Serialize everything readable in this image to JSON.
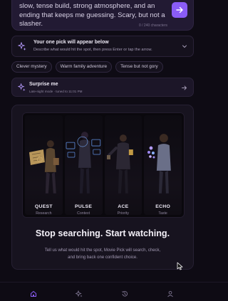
{
  "prompt": {
    "text": "slow, tense build, strong atmosphere, and an ending that keeps me guessing. Scary, but not a slasher.",
    "char_count": "0 / 240 characters"
  },
  "pick": {
    "title": "Your one pick will appear below",
    "subtitle": "Describe what would hit the spot, then press Enter or tap the arrow."
  },
  "chips": [
    "Clever mystery",
    "Warm family adventure",
    "Tense but not gory"
  ],
  "surprise": {
    "title": "Surprise me",
    "subtitle": "Late-night mode · tuned to 11:01 PM"
  },
  "agents": [
    {
      "name": "QUEST",
      "role": "Research"
    },
    {
      "name": "PULSE",
      "role": "Context"
    },
    {
      "name": "ACE",
      "role": "Priority"
    },
    {
      "name": "ECHO",
      "role": "Taste"
    }
  ],
  "hero": {
    "headline": "Stop searching. Start watching.",
    "body": "Tell us what would hit the spot, Movie Pick will search, check, and bring back one confident choice."
  },
  "nav": [
    "home-icon",
    "sparkle-icon",
    "history-icon",
    "profile-icon"
  ],
  "colors": {
    "accent": "#8a5cf6",
    "background": "#0e0b14"
  }
}
